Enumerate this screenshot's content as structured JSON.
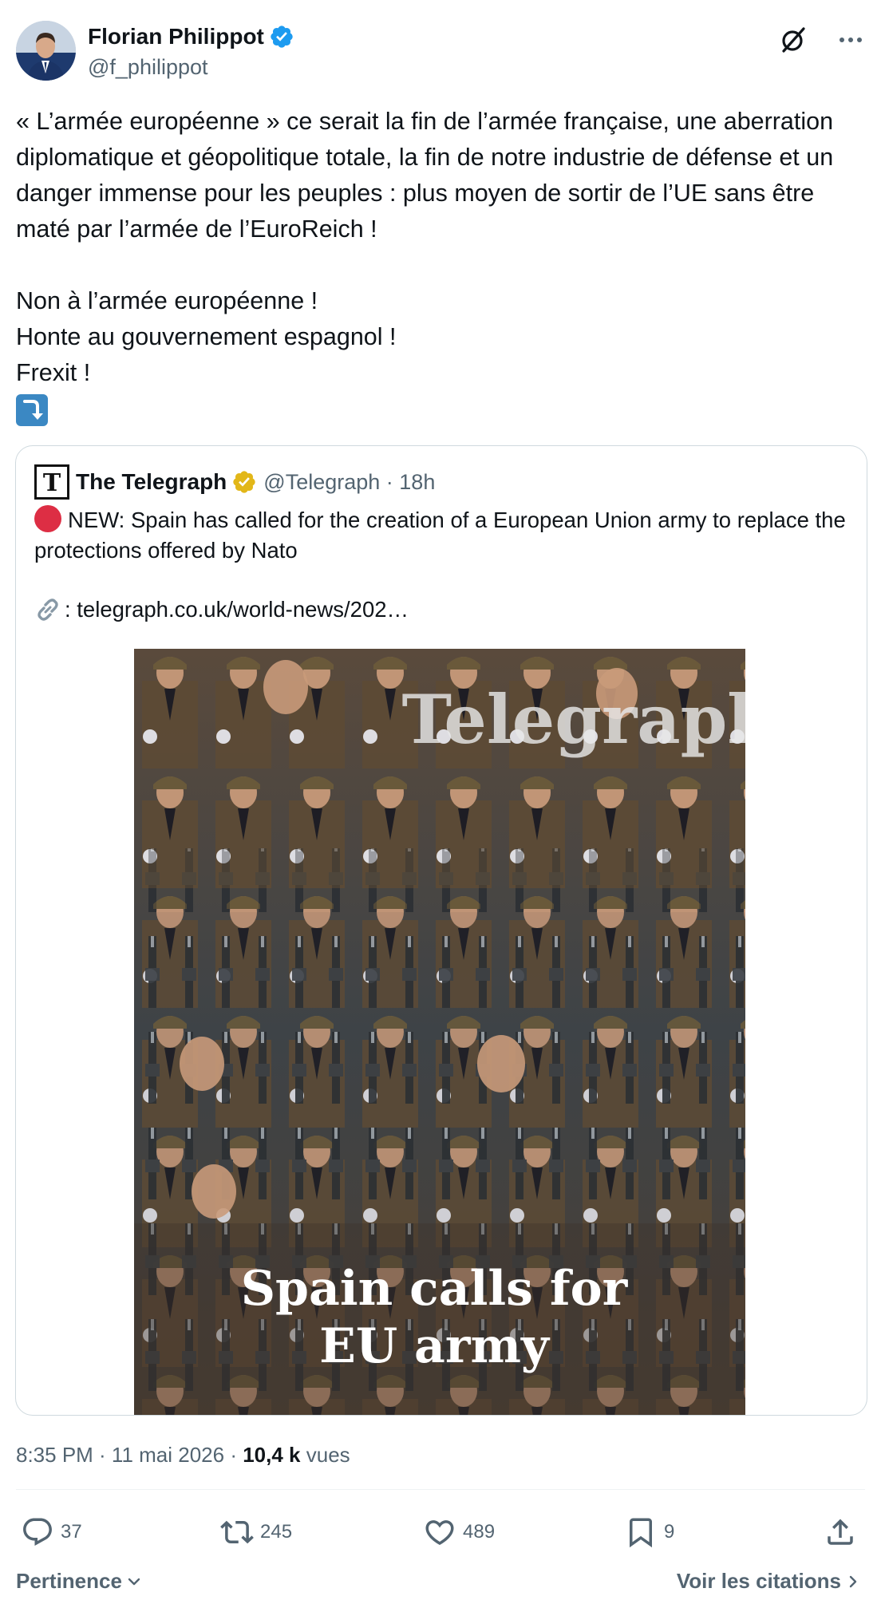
{
  "author": {
    "display_name": "Florian Philippot",
    "handle": "@f_philippot"
  },
  "tweet": {
    "text": "« L’armée européenne » ce serait la fin de l’armée française, une aberration diplomatique et géopolitique totale, la fin de notre industrie de défense et un danger immense pour les peuples : plus moyen de sortir de l’UE sans être maté par l’armée de l’EuroReich !\n\nNon à l’armée européenne !\nHonte au gouvernement espagnol !\nFrexit !",
    "emoji_icon": "arrow-curving-down-icon"
  },
  "quote": {
    "display_name": "The Telegraph",
    "handle_time": "@Telegraph · 18h",
    "text": "NEW: Spain has called for the creation of a European Union army to replace the protections offered by Nato",
    "link_text": ": telegraph.co.uk/world-news/202…",
    "image": {
      "watermark": "Telegraph",
      "headline_line1": "Spain calls for",
      "headline_line2": "EU army"
    }
  },
  "meta": {
    "time_date": "8:35 PM · 11 mai 2026 · ",
    "views_count": "10,4 k",
    "views_label": " vues"
  },
  "actions": {
    "replies": "37",
    "reposts": "245",
    "likes": "489",
    "bookmarks": "9"
  },
  "footer": {
    "sort_label": "Pertinence",
    "quotes_label": "Voir les citations"
  },
  "colors": {
    "verified_blue": "#1d9bf0",
    "gold_badge": "#e2b719",
    "secondary_text": "#536471"
  }
}
